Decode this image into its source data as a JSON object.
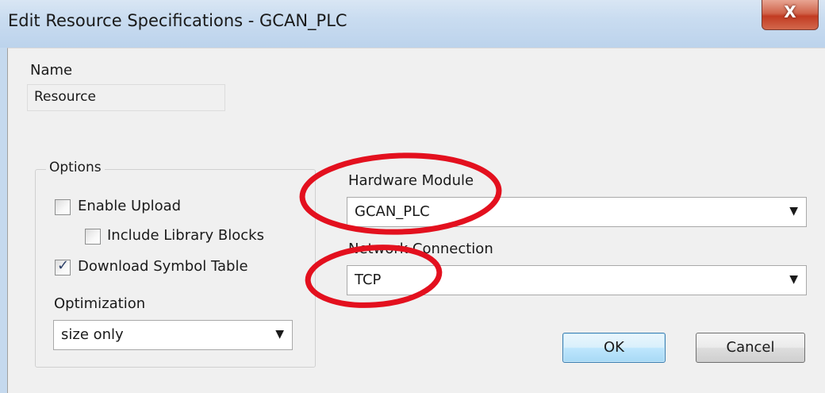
{
  "window": {
    "title": "Edit Resource Specifications - GCAN_PLC",
    "close_glyph": "X",
    "close_icon": "close-icon"
  },
  "name": {
    "label": "Name",
    "value": "Resource"
  },
  "options": {
    "label": "Options",
    "enable_upload": {
      "label": "Enable Upload",
      "checked": false
    },
    "include_library_blocks": {
      "label": "Include Library Blocks",
      "checked": false
    },
    "download_symbol_table": {
      "label": "Download Symbol Table",
      "checked": true
    },
    "optimization": {
      "label": "Optimization",
      "selected": "size only"
    }
  },
  "hardware_module": {
    "label": "Hardware Module",
    "selected": "GCAN_PLC"
  },
  "network_connection": {
    "label": "Network Connection",
    "selected": "TCP"
  },
  "buttons": {
    "ok": "OK",
    "cancel": "Cancel"
  },
  "colors": {
    "annotation_red": "#e3101e",
    "title_bar": "#c9dcf0",
    "dialog_bg": "#f0f0f0"
  },
  "icons": {
    "dropdown": "chevron-down-icon",
    "checkmark": "checkmark-icon"
  }
}
